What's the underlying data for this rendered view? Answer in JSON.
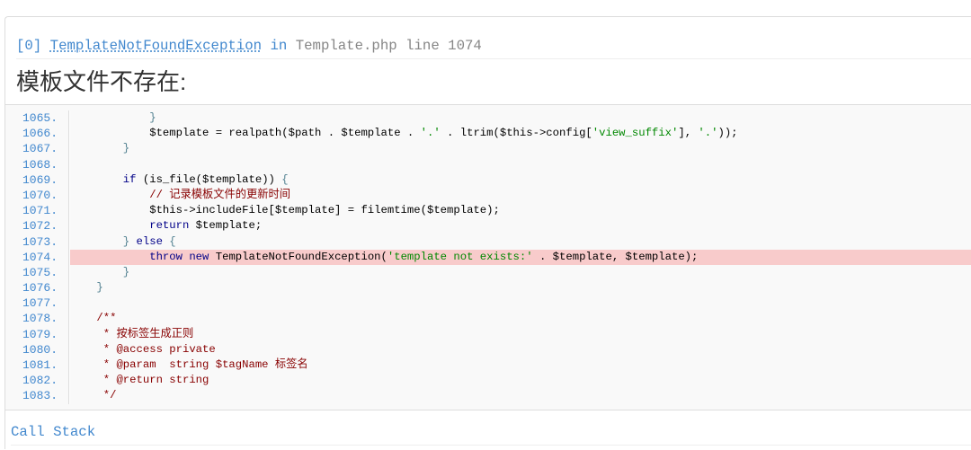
{
  "exception": {
    "index": "[0]",
    "class_name": "TemplateNotFoundException",
    "in_label": "in",
    "location": "Template.php line 1074",
    "message": "模板文件不存在:"
  },
  "source_code": {
    "lines": [
      {
        "number": "1065.",
        "error": false,
        "tokens": [
          {
            "pun": "            }"
          }
        ]
      },
      {
        "number": "1066.",
        "error": false,
        "tokens": [
          {
            "pln": "            $template = realpath($path . $template . "
          },
          {
            "str": "'.'"
          },
          {
            "pln": " . ltrim($this->config["
          },
          {
            "str": "'view_suffix'"
          },
          {
            "pln": "], "
          },
          {
            "str": "'.'"
          },
          {
            "pln": "));"
          }
        ]
      },
      {
        "number": "1067.",
        "error": false,
        "tokens": [
          {
            "pun": "        }"
          }
        ]
      },
      {
        "number": "1068.",
        "error": false,
        "tokens": []
      },
      {
        "number": "1069.",
        "error": false,
        "tokens": [
          {
            "kwd": "        if"
          },
          {
            "pln": " (is_file($template)) "
          },
          {
            "pun": "{"
          }
        ]
      },
      {
        "number": "1070.",
        "error": false,
        "tokens": [
          {
            "com": "            // 记录模板文件的更新时间"
          }
        ]
      },
      {
        "number": "1071.",
        "error": false,
        "tokens": [
          {
            "pln": "            $this->includeFile[$template] = filemtime($template);"
          }
        ]
      },
      {
        "number": "1072.",
        "error": false,
        "tokens": [
          {
            "kwd": "            return"
          },
          {
            "pln": " $template;"
          }
        ]
      },
      {
        "number": "1073.",
        "error": false,
        "tokens": [
          {
            "pun": "        }"
          },
          {
            "kwd": " else"
          },
          {
            "pun": " {"
          }
        ]
      },
      {
        "number": "1074.",
        "error": true,
        "tokens": [
          {
            "kwd": "            throw new"
          },
          {
            "pln": " TemplateNotFoundException("
          },
          {
            "str": "'template not exists:'"
          },
          {
            "pln": " . $template, $template);"
          }
        ]
      },
      {
        "number": "1075.",
        "error": false,
        "tokens": [
          {
            "pun": "        }"
          }
        ]
      },
      {
        "number": "1076.",
        "error": false,
        "tokens": [
          {
            "pun": "    }"
          }
        ]
      },
      {
        "number": "1077.",
        "error": false,
        "tokens": []
      },
      {
        "number": "1078.",
        "error": false,
        "tokens": [
          {
            "com": "    /**"
          }
        ]
      },
      {
        "number": "1079.",
        "error": false,
        "tokens": [
          {
            "com": "     * 按标签生成正则"
          }
        ]
      },
      {
        "number": "1080.",
        "error": false,
        "tokens": [
          {
            "com": "     * @access private"
          }
        ]
      },
      {
        "number": "1081.",
        "error": false,
        "tokens": [
          {
            "com": "     * @param  string $tagName 标签名"
          }
        ]
      },
      {
        "number": "1082.",
        "error": false,
        "tokens": [
          {
            "com": "     * @return string"
          }
        ]
      },
      {
        "number": "1083.",
        "error": false,
        "tokens": [
          {
            "com": "     */"
          }
        ]
      }
    ]
  },
  "call_stack": {
    "title": "Call Stack"
  },
  "colors": {
    "accent": "#4288ce",
    "link": "#868686",
    "border": "#dddddd",
    "code_background": "#f9f9f9",
    "error_line": "#f8cbcb",
    "plain": "#000000",
    "keyword": "#000088",
    "string": "#008800",
    "comment": "#880000",
    "punctuation": "#4f7f8f",
    "heading": "#333333"
  }
}
